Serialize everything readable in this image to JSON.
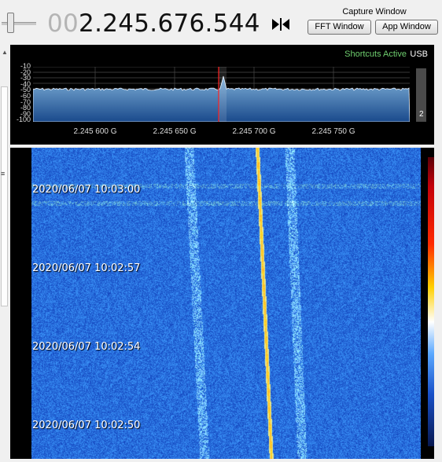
{
  "frequency": {
    "leading": "00",
    "value": "2.245.676.544"
  },
  "capture": {
    "label": "Capture Window",
    "fft_button": "FFT Window",
    "app_button": "App Window"
  },
  "spectrum": {
    "status": "Shortcuts Active",
    "mode": "USB",
    "y_ticks": [
      "-10",
      "-20",
      "-30",
      "-40",
      "-50",
      "-60",
      "-70",
      "-80",
      "-90",
      "-100"
    ],
    "x_ticks": [
      "2.245 600 G",
      "2.245 650 G",
      "2.245 700 G",
      "2.245 750 G"
    ],
    "level_value": "2"
  },
  "waterfall": {
    "timestamps": [
      "2020/06/07 10:03:00",
      "2020/06/07 10:02:57",
      "2020/06/07 10:02:54",
      "2020/06/07 10:02:50"
    ]
  },
  "colors": {
    "spectrum_fill_top": "#7fb0d8",
    "spectrum_fill_bottom": "#1a4a8c",
    "waterfall_bg": "#2a5fd0",
    "marker": "#ff2020",
    "status_green": "#6fcf6f"
  },
  "icons": {
    "swap": "bowtie-icon"
  }
}
